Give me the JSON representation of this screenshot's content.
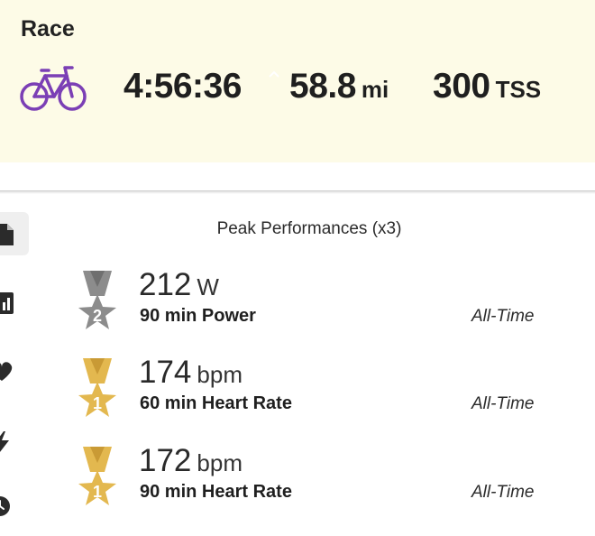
{
  "activity": {
    "title": "Race",
    "icon": "bike-icon",
    "accent_color": "#7b3fb5",
    "stats": [
      {
        "value": "4:56:36",
        "unit": ""
      },
      {
        "value": "58.8",
        "unit": "mi"
      },
      {
        "value": "300",
        "unit": "TSS"
      }
    ]
  },
  "sidebar": {
    "items": [
      {
        "icon": "document-icon",
        "active": true
      },
      {
        "icon": "chart-icon",
        "active": false
      },
      {
        "icon": "heart-icon",
        "active": false
      },
      {
        "icon": "lightning-icon",
        "active": false
      },
      {
        "icon": "clock-icon",
        "active": false
      }
    ]
  },
  "peak_performances": {
    "title": "Peak Performances (x3)",
    "items": [
      {
        "value": "212",
        "unit": "W",
        "label": "90 min Power",
        "range": "All-Time",
        "rank": "2",
        "medal": "silver"
      },
      {
        "value": "174",
        "unit": "bpm",
        "label": "60 min Heart Rate",
        "range": "All-Time",
        "rank": "1",
        "medal": "gold"
      },
      {
        "value": "172",
        "unit": "bpm",
        "label": "90 min Heart Rate",
        "range": "All-Time",
        "rank": "1",
        "medal": "gold"
      }
    ]
  },
  "colors": {
    "header_bg": "#fdfbe7",
    "gold": "#e3b84f",
    "silver": "#8c8c8c"
  }
}
